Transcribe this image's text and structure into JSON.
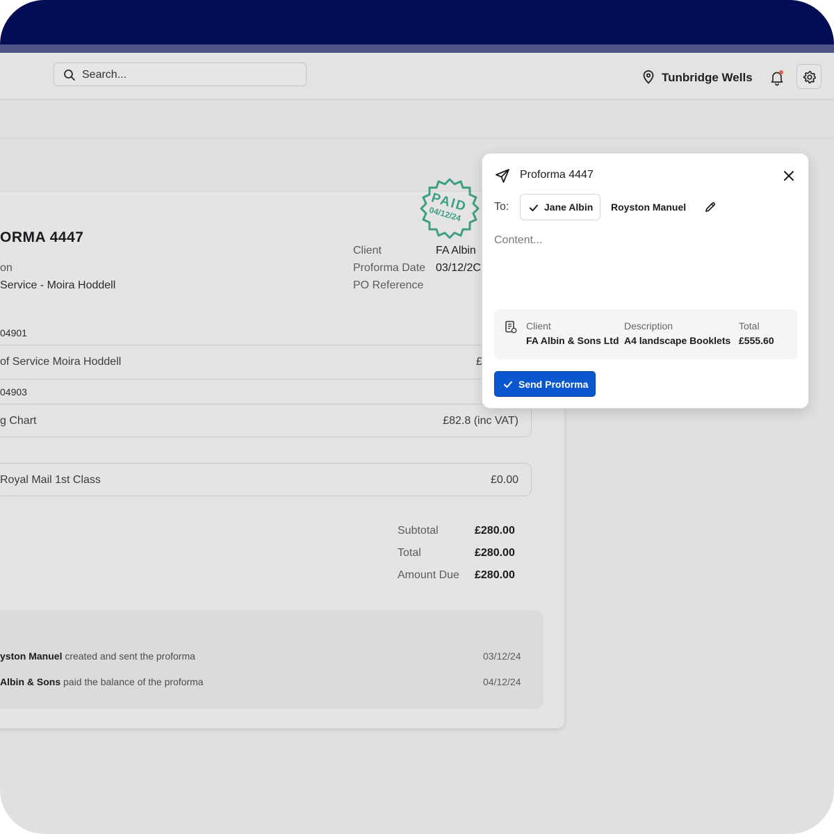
{
  "header": {
    "search_placeholder": "Search...",
    "location": "Tunbridge Wells"
  },
  "document": {
    "title": "ORMA 4447",
    "left_label": "on",
    "left_value": "Service - Moira Hoddell",
    "client_label": "Client",
    "client_value": "FA Albin",
    "date_label": "Proforma Date",
    "date_value": "03/12/2C",
    "po_label": "PO Reference",
    "stamp_text": "PAID",
    "stamp_date": "04/12/24",
    "items": [
      {
        "ref": "04901",
        "name": "of Service Moira Hoddell",
        "price": "£"
      },
      {
        "ref": "04903",
        "name": "g Chart",
        "price": "£82.8 (inc VAT)"
      },
      {
        "ref": "",
        "name": "Royal Mail 1st Class",
        "price": "£0.00"
      }
    ],
    "totals": [
      {
        "label": "Subtotal",
        "value": "£280.00"
      },
      {
        "label": "Total",
        "value": "£280.00"
      },
      {
        "label": "Amount Due",
        "value": "£280.00"
      }
    ],
    "activity": [
      {
        "actor": "yston Manuel",
        "action": "created and sent the proforma",
        "date": "03/12/24"
      },
      {
        "actor": "Albin & Sons",
        "action": "paid the balance of the proforma",
        "date": "04/12/24"
      }
    ]
  },
  "modal": {
    "title": "Proforma 4447",
    "to_label": "To:",
    "recipients": [
      "Jane Albin",
      "Royston Manuel"
    ],
    "content_placeholder": "Content...",
    "summary": {
      "client_label": "Client",
      "client_value": "FA Albin & Sons Ltd",
      "description_label": "Description",
      "description_value": "A4 landscape Booklets",
      "total_label": "Total",
      "total_value": "£555.60"
    },
    "send_label": "Send Proforma"
  },
  "colors": {
    "topbar": "#030d55",
    "accent_blue": "#0b57d0",
    "stamp_green": "#3e9e84",
    "notification_dot": "#e5624a"
  }
}
